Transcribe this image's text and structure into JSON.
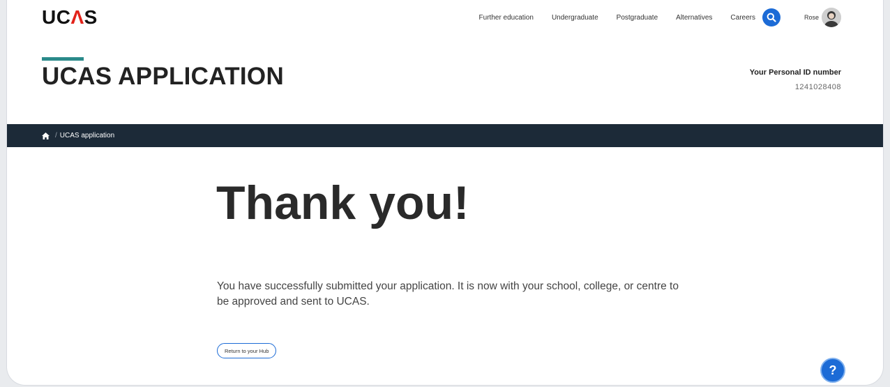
{
  "header": {
    "logo_text_1": "UC",
    "logo_caret": "Λ",
    "logo_text_2": "S",
    "nav": [
      "Further education",
      "Undergraduate",
      "Postgraduate",
      "Alternatives",
      "Careers"
    ],
    "user_name": "Rose",
    "icons": {
      "search": "search-icon",
      "avatar": "user-avatar-icon"
    }
  },
  "page": {
    "title": "UCAS APPLICATION",
    "personal_id_label": "Your Personal ID number",
    "personal_id_value": "1241028408"
  },
  "breadcrumb": {
    "home_icon": "home-icon",
    "separator": "/",
    "current": "UCAS application"
  },
  "main": {
    "heading": "Thank you!",
    "message": "You have successfully submitted your application. It is now with your school, college, or centre to be approved and sent to UCAS.",
    "return_button": "Return to your Hub"
  },
  "help_button": "?",
  "colors": {
    "accent_blue": "#1c6bd6",
    "breadcrumb_bg": "#1c2a38",
    "title_accent": "#2a8a8a",
    "logo_red": "#e2231a"
  }
}
